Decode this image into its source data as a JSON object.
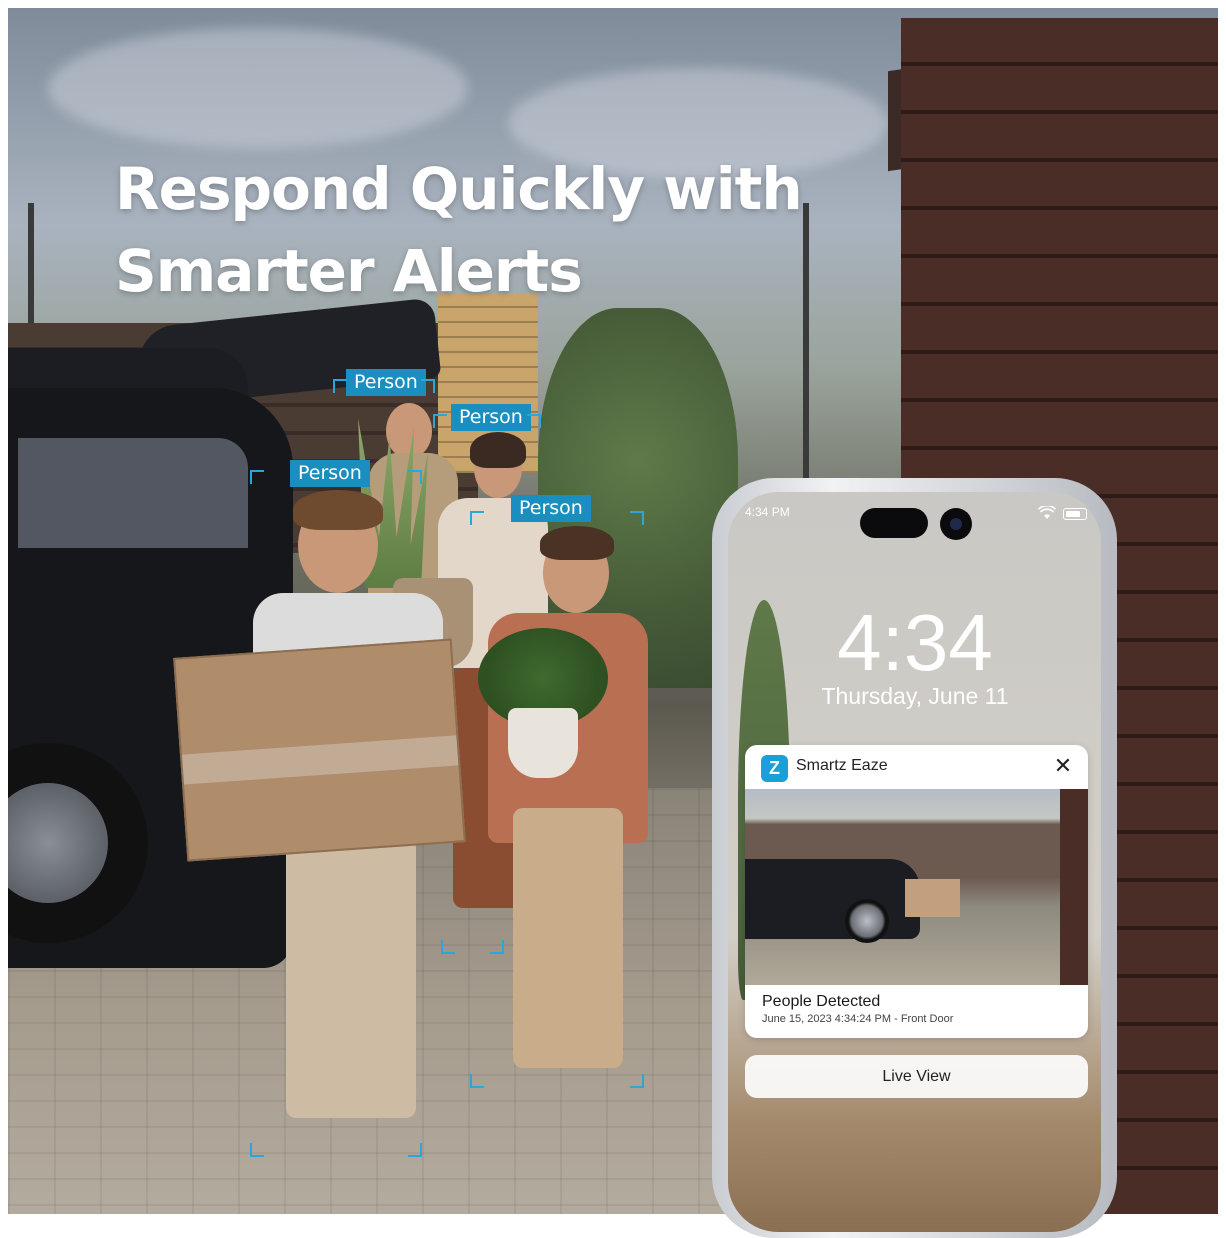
{
  "headline": {
    "line1": "Respond Quickly with",
    "line2": "Smarter Alerts"
  },
  "detections": [
    {
      "label": "Person"
    },
    {
      "label": "Person"
    },
    {
      "label": "Person"
    },
    {
      "label": "Person"
    }
  ],
  "phone": {
    "status_time": "4:34 PM",
    "lock_time": "4:34",
    "lock_date": "Thursday, June 11",
    "notification": {
      "app_icon_letter": "Z",
      "app_name": "Smartz Eaze",
      "close_symbol": "✕",
      "title": "People Detected",
      "subtitle": "June 15, 2023 4:34:24 PM - Front Door"
    },
    "live_view_label": "Live View"
  },
  "colors": {
    "detection_accent": "#1a8fbf",
    "app_icon": "#1a9fd9"
  },
  "icons": [
    "wifi-icon",
    "battery-icon",
    "close-icon",
    "app-logo-icon",
    "front-camera-icon"
  ]
}
